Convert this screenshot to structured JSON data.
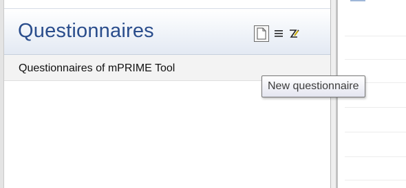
{
  "panel": {
    "title": "Questionnaires",
    "toolbar": {
      "new_icon": "new-document-icon",
      "list_icon": "list-icon",
      "rename_icon": "rename-icon"
    },
    "items": [
      {
        "label": "Questionnaires of mPRIME Tool"
      }
    ]
  },
  "tooltip": {
    "text": "New questionnaire"
  },
  "colors": {
    "title": "#2a4d8c",
    "header_gradient_end": "#e3e9f3",
    "selected_row": "#f3f3f3"
  }
}
